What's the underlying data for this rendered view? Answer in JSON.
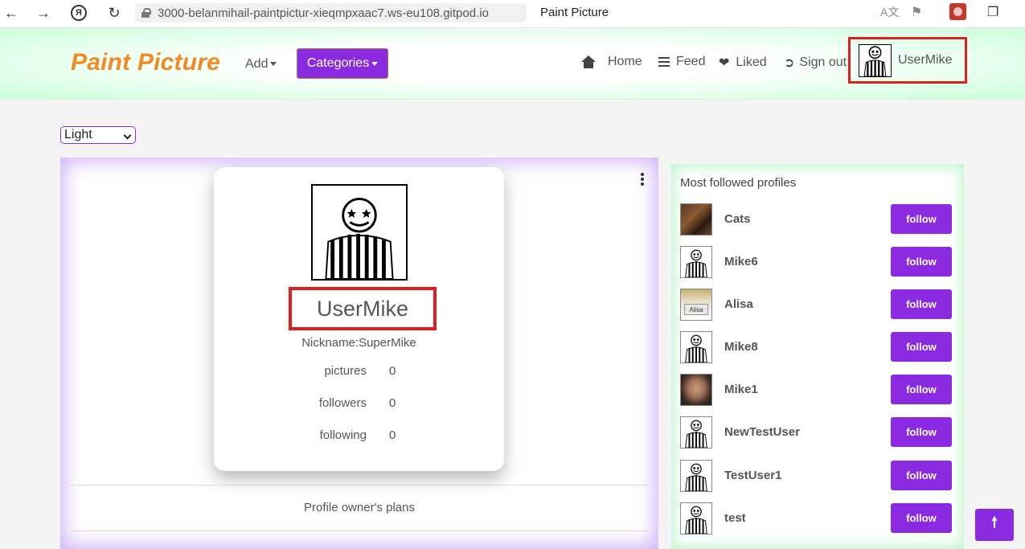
{
  "browser": {
    "url": "3000-belanmihail-paintpictur-xieqmpxaac7.ws-eu108.gitpod.io",
    "page_title": "Paint Picture",
    "yandex_label": "Я"
  },
  "navbar": {
    "brand": "Paint Picture",
    "add_label": "Add",
    "categories_label": "Categories",
    "links": {
      "home": "Home",
      "feed": "Feed",
      "liked": "Liked",
      "sign_out": "Sign out"
    },
    "username": "UserMike"
  },
  "theme_select": {
    "selected": "Light"
  },
  "profile": {
    "name": "UserMike",
    "nickname": "Nickname:SuperMike",
    "stats": [
      {
        "label": "pictures",
        "value": "0"
      },
      {
        "label": "followers",
        "value": "0"
      },
      {
        "label": "following",
        "value": "0"
      }
    ],
    "plans_label": "Profile owner's plans"
  },
  "sidebar": {
    "title": "Most followed profiles",
    "follow_label": "follow",
    "alisa_tag": "Alisa",
    "profiles": [
      {
        "name": "Cats",
        "avatar": "cat-photo"
      },
      {
        "name": "Mike6",
        "avatar": "default-avatar"
      },
      {
        "name": "Alisa",
        "avatar": "alisa-photo"
      },
      {
        "name": "Mike8",
        "avatar": "default-avatar"
      },
      {
        "name": "Mike1",
        "avatar": "face-photo"
      },
      {
        "name": "NewTestUser",
        "avatar": "default-avatar"
      },
      {
        "name": "TestUser1",
        "avatar": "default-avatar"
      },
      {
        "name": "test",
        "avatar": "default-avatar"
      }
    ]
  },
  "colors": {
    "accent_purple": "#8a2be2",
    "brand_orange": "#f08a24",
    "highlight_red": "#e02020"
  }
}
